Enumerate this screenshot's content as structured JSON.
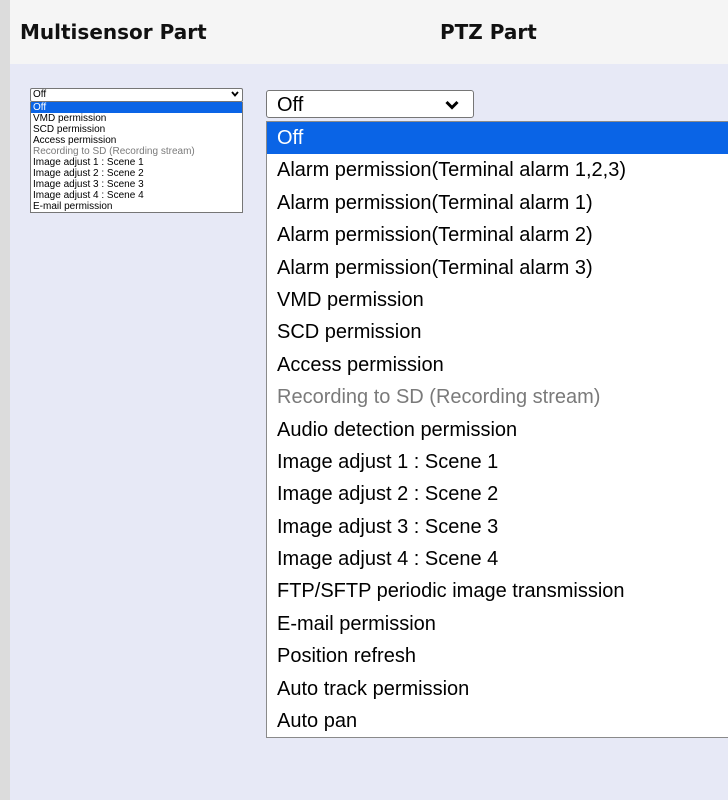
{
  "headers": {
    "multisensor": "Multisensor Part",
    "ptz": "PTZ Part"
  },
  "multisensor_dropdown": {
    "selected": "Off",
    "options": [
      {
        "label": "Off",
        "selected": true
      },
      {
        "label": "VMD permission"
      },
      {
        "label": "SCD permission"
      },
      {
        "label": "Access permission"
      },
      {
        "label": "Recording to SD (Recording stream)",
        "disabled": true
      },
      {
        "label": "Image adjust 1 : Scene 1"
      },
      {
        "label": "Image adjust 2 : Scene 2"
      },
      {
        "label": "Image adjust 3 : Scene 3"
      },
      {
        "label": "Image adjust 4 : Scene 4"
      },
      {
        "label": "E-mail permission"
      }
    ]
  },
  "ptz_dropdown": {
    "selected": "Off",
    "options": [
      {
        "label": "Off",
        "selected": true
      },
      {
        "label": "Alarm permission(Terminal alarm 1,2,3)"
      },
      {
        "label": "Alarm permission(Terminal alarm 1)"
      },
      {
        "label": "Alarm permission(Terminal alarm 2)"
      },
      {
        "label": "Alarm permission(Terminal alarm 3)"
      },
      {
        "label": "VMD permission"
      },
      {
        "label": "SCD permission"
      },
      {
        "label": "Access permission"
      },
      {
        "label": "Recording to SD (Recording stream)",
        "disabled": true
      },
      {
        "label": "Audio detection permission"
      },
      {
        "label": "Image adjust 1 : Scene 1"
      },
      {
        "label": "Image adjust 2 : Scene 2"
      },
      {
        "label": "Image adjust 3 : Scene 3"
      },
      {
        "label": "Image adjust 4 : Scene 4"
      },
      {
        "label": "FTP/SFTP periodic image transmission"
      },
      {
        "label": "E-mail permission"
      },
      {
        "label": "Position refresh"
      },
      {
        "label": "Auto track permission"
      },
      {
        "label": "Auto pan"
      }
    ]
  },
  "colors": {
    "highlight": "#0a64e6",
    "content_bg": "#e7e9f6",
    "disabled_text": "#7a7a7a"
  },
  "icons": {
    "dropdown_arrow": "chevron-down-icon"
  }
}
